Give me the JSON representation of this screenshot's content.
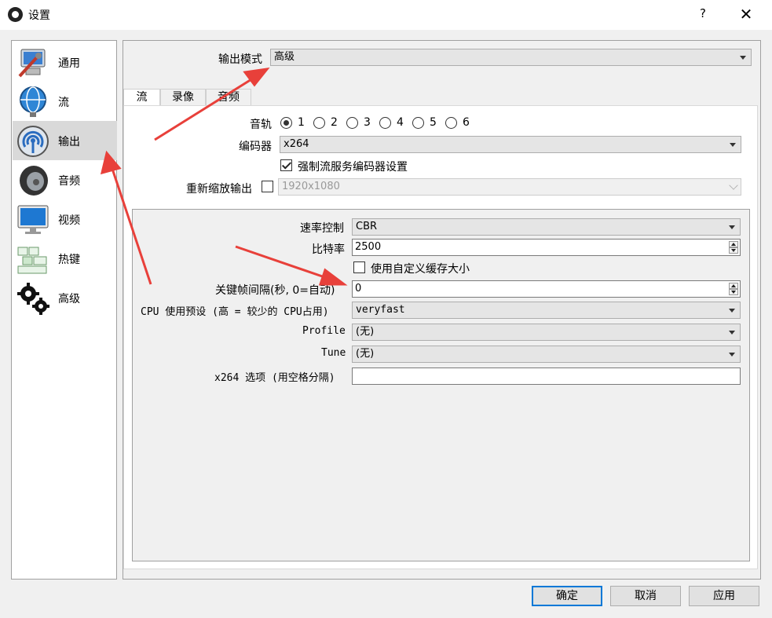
{
  "window": {
    "title": "设置",
    "help_label": "?",
    "close_label": "✕"
  },
  "sidebar": {
    "items": [
      {
        "label": "通用",
        "icon": "general-settings-icon"
      },
      {
        "label": "流",
        "icon": "stream-icon"
      },
      {
        "label": "输出",
        "icon": "output-icon",
        "active": true
      },
      {
        "label": "音频",
        "icon": "audio-speaker-icon"
      },
      {
        "label": "视频",
        "icon": "video-monitor-icon"
      },
      {
        "label": "热键",
        "icon": "hotkeys-keyboard-icon"
      },
      {
        "label": "高级",
        "icon": "advanced-gears-icon"
      }
    ]
  },
  "output_mode": {
    "label": "输出模式",
    "value": "高级"
  },
  "tabs": [
    {
      "label": "流",
      "active": true
    },
    {
      "label": "录像"
    },
    {
      "label": "音频"
    }
  ],
  "stream": {
    "track_label": "音轨",
    "tracks": [
      "1",
      "2",
      "3",
      "4",
      "5",
      "6"
    ],
    "selected_track": "1",
    "encoder_label": "编码器",
    "encoder_value": "x264",
    "enforce_label": "强制流服务编码器设置",
    "enforce_checked": true,
    "rescale_label": "重新缩放输出",
    "rescale_checked": false,
    "rescale_value": "1920x1080"
  },
  "encoder_settings": {
    "rate_control_label": "速率控制",
    "rate_control_value": "CBR",
    "bitrate_label": "比特率",
    "bitrate_value": "2500",
    "custom_buffer_label": "使用自定义缓存大小",
    "custom_buffer_checked": false,
    "keyframe_label": "关键帧间隔(秒, 0=自动)",
    "keyframe_value": "0",
    "cpu_preset_label": "CPU 使用预设 (高 = 较少的 CPU占用)",
    "cpu_preset_value": "veryfast",
    "profile_label": "Profile",
    "profile_value": "(无)",
    "tune_label": "Tune",
    "tune_value": "(无)",
    "x264_options_label": "x264 选项 (用空格分隔)",
    "x264_options_value": ""
  },
  "buttons": {
    "ok": "确定",
    "cancel": "取消",
    "apply": "应用"
  },
  "colors": {
    "accent": "#0078d7",
    "annotation_arrow": "#e8403a"
  }
}
